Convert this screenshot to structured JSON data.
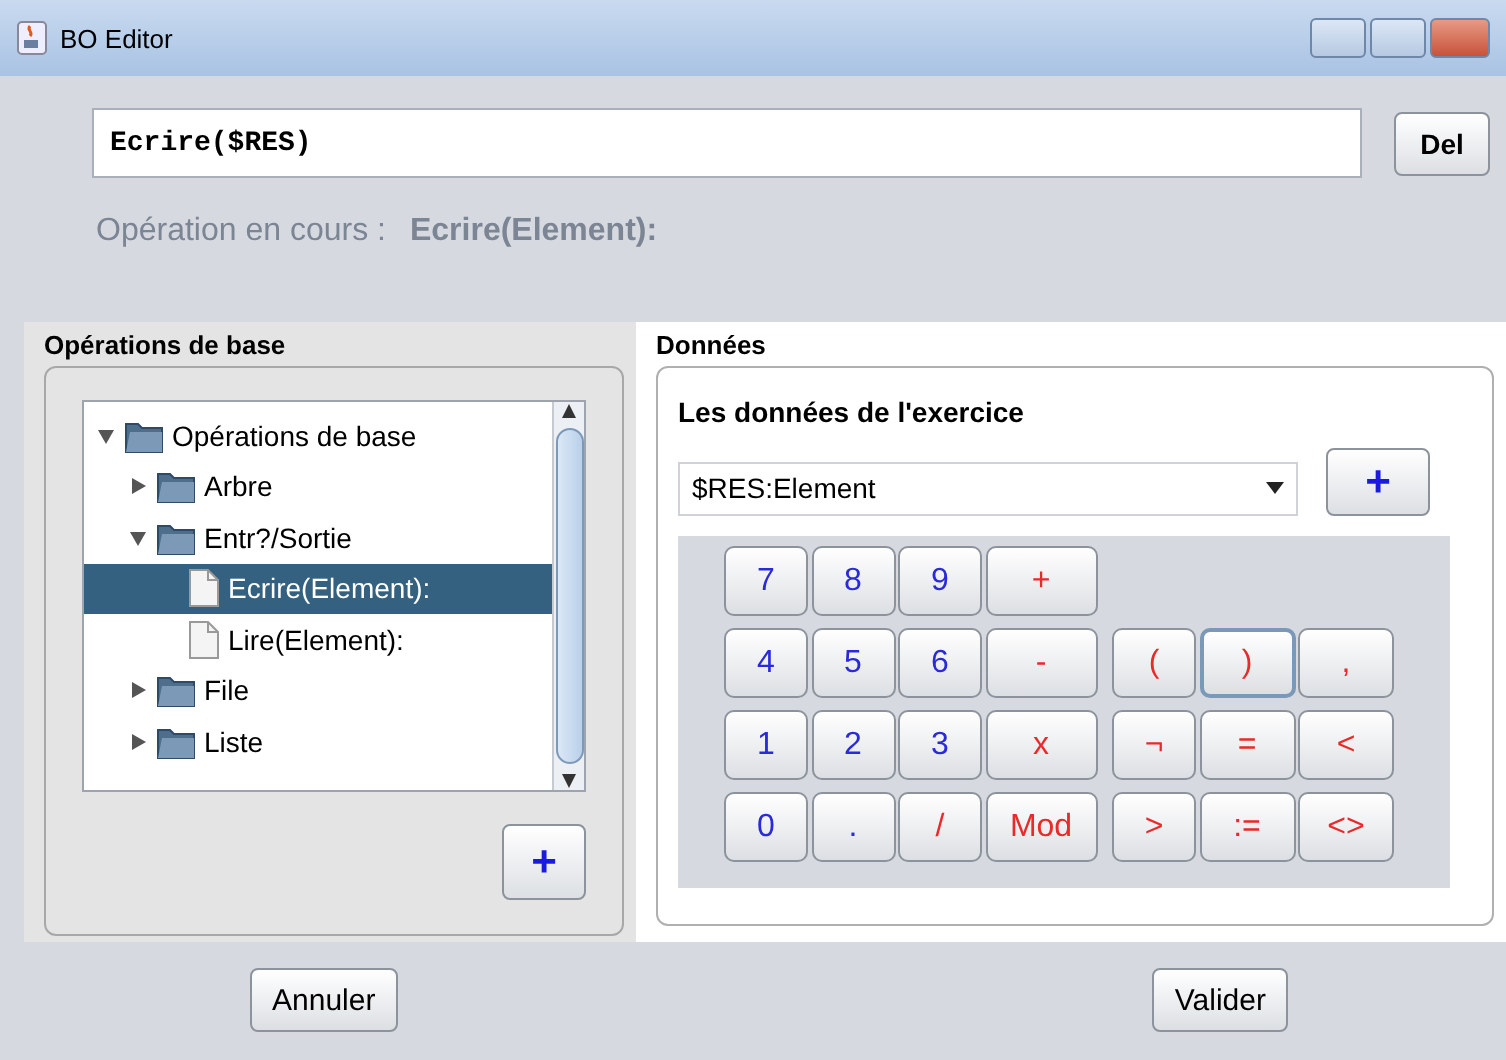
{
  "window": {
    "title": "BO Editor"
  },
  "expression": {
    "value": "Ecrire($RES)"
  },
  "del_button": "Del",
  "current_operation": {
    "label": "Opération en cours :",
    "value": "Ecrire(Element):"
  },
  "operations_panel": {
    "title": "Opérations de base",
    "add_button": "+",
    "tree": [
      {
        "label": "Opérations de base",
        "kind": "folder",
        "expanded": true,
        "selected": false,
        "children": [
          {
            "label": "Arbre",
            "kind": "folder",
            "expanded": false,
            "selected": false
          },
          {
            "label": "Entr?/Sortie",
            "kind": "folder",
            "expanded": true,
            "selected": false,
            "children": [
              {
                "label": "Ecrire(Element):",
                "kind": "leaf",
                "selected": true
              },
              {
                "label": "Lire(Element):",
                "kind": "leaf",
                "selected": false
              }
            ]
          },
          {
            "label": "File",
            "kind": "folder",
            "expanded": false,
            "selected": false
          },
          {
            "label": "Liste",
            "kind": "folder",
            "expanded": false,
            "selected": false
          }
        ]
      }
    ]
  },
  "data_panel": {
    "title": "Données",
    "subtitle": "Les données de l'exercice",
    "combo": {
      "value": "$RES:Element"
    },
    "add_button": "+",
    "keypad": {
      "number_keys": [
        [
          {
            "label": "7",
            "kind": "digit",
            "focused": false
          },
          {
            "label": "8",
            "kind": "digit",
            "focused": false
          },
          {
            "label": "9",
            "kind": "digit",
            "focused": false
          },
          {
            "label": "+",
            "kind": "operator",
            "focused": false
          }
        ],
        [
          {
            "label": "4",
            "kind": "digit",
            "focused": false
          },
          {
            "label": "5",
            "kind": "digit",
            "focused": false
          },
          {
            "label": "6",
            "kind": "digit",
            "focused": false
          },
          {
            "label": "-",
            "kind": "operator",
            "focused": false
          }
        ],
        [
          {
            "label": "1",
            "kind": "digit",
            "focused": false
          },
          {
            "label": "2",
            "kind": "digit",
            "focused": false
          },
          {
            "label": "3",
            "kind": "digit",
            "focused": false
          },
          {
            "label": "x",
            "kind": "operator",
            "focused": false
          }
        ],
        [
          {
            "label": "0",
            "kind": "digit",
            "focused": false
          },
          {
            "label": ".",
            "kind": "digit",
            "focused": false
          },
          {
            "label": "/",
            "kind": "operator",
            "focused": false
          },
          {
            "label": "Mod",
            "kind": "operator",
            "focused": false
          }
        ]
      ],
      "symbol_keys": [
        [
          {
            "label": "(",
            "kind": "operator",
            "focused": false
          },
          {
            "label": ")",
            "kind": "operator",
            "focused": true
          },
          {
            "label": ",",
            "kind": "operator",
            "focused": false
          }
        ],
        [
          {
            "label": "¬",
            "kind": "operator",
            "focused": false
          },
          {
            "label": "=",
            "kind": "operator",
            "focused": false
          },
          {
            "label": "<",
            "kind": "operator",
            "focused": false
          }
        ],
        [
          {
            "label": ">",
            "kind": "operator",
            "focused": false
          },
          {
            "label": ":=",
            "kind": "operator",
            "focused": false
          },
          {
            "label": "<>",
            "kind": "operator",
            "focused": false
          }
        ]
      ]
    }
  },
  "buttons": [
    "Annuler",
    "Valider"
  ]
}
